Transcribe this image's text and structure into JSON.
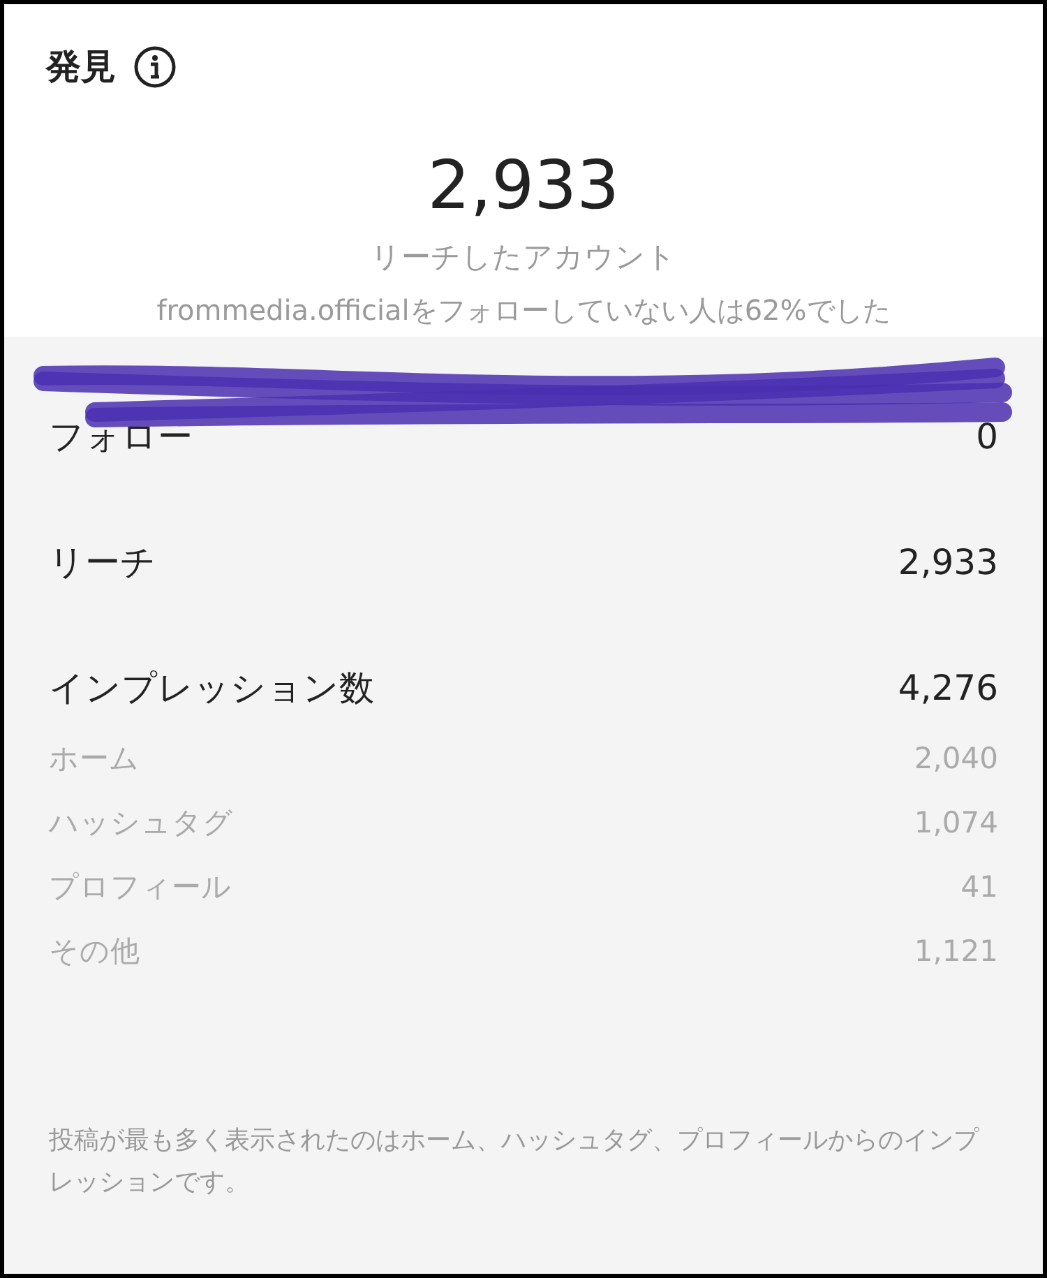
{
  "title": "発見",
  "summary": {
    "value": "2,933",
    "caption": "リーチしたアカウント",
    "note": "frommedia.officialをフォローしていない人は62%でした"
  },
  "metrics": [
    {
      "label": "フォロー",
      "value": "0",
      "kind": "main"
    },
    {
      "label": "リーチ",
      "value": "2,933",
      "kind": "main"
    },
    {
      "label": "インプレッション数",
      "value": "4,276",
      "kind": "main"
    },
    {
      "label": "ホーム",
      "value": "2,040",
      "kind": "sub"
    },
    {
      "label": "ハッシュタグ",
      "value": "1,074",
      "kind": "sub"
    },
    {
      "label": "プロフィール",
      "value": "41",
      "kind": "sub"
    },
    {
      "label": "その他",
      "value": "1,121",
      "kind": "sub"
    }
  ],
  "footnote": "投稿が最も多く表示されたのはホーム、ハッシュタグ、プロフィールからのインプレッションです。"
}
